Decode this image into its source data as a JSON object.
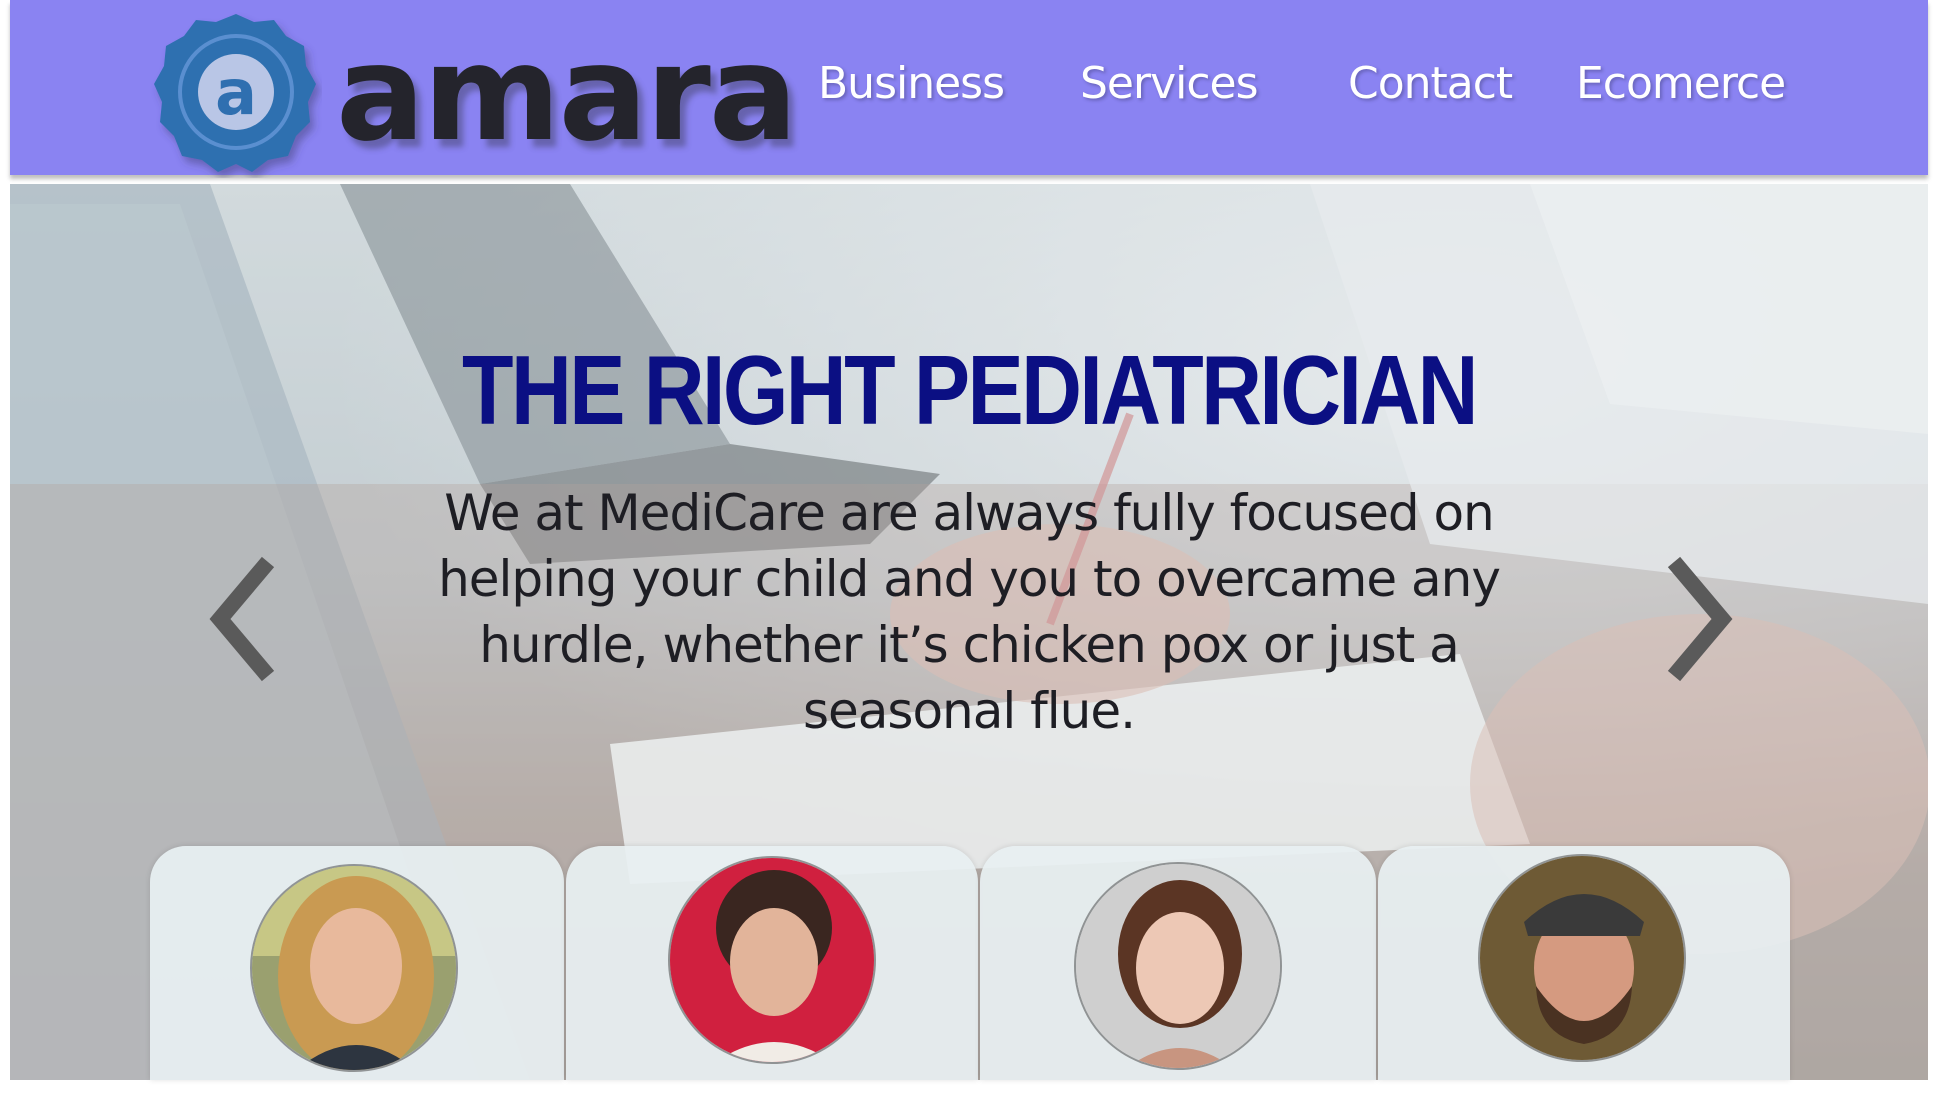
{
  "brand": {
    "name": "amara",
    "badge_letter": "a"
  },
  "nav": {
    "items": [
      {
        "label": "Business"
      },
      {
        "label": "Services"
      },
      {
        "label": "Contact"
      },
      {
        "label": "Ecomerce"
      }
    ]
  },
  "hero": {
    "title": "THE RIGHT PEDIATRICIAN",
    "text": "We at MediCare are always fully focused on helping your child and you to overcame any hurdle, whether it’s chicken pox or just a seasonal flue."
  },
  "carousel": {
    "prev_icon": "chevron-left-icon",
    "next_icon": "chevron-right-icon"
  },
  "team": {
    "members": [
      {
        "avatar": "woman-blonde-portrait"
      },
      {
        "avatar": "woman-curly-hair-portrait"
      },
      {
        "avatar": "woman-brown-hair-portrait"
      },
      {
        "avatar": "man-cap-beard-portrait"
      }
    ]
  },
  "colors": {
    "header_bg": "#8a83f2",
    "title": "#0b0f83",
    "nav_text": "#ffffff",
    "logo_badge": "#2f6fb0"
  }
}
